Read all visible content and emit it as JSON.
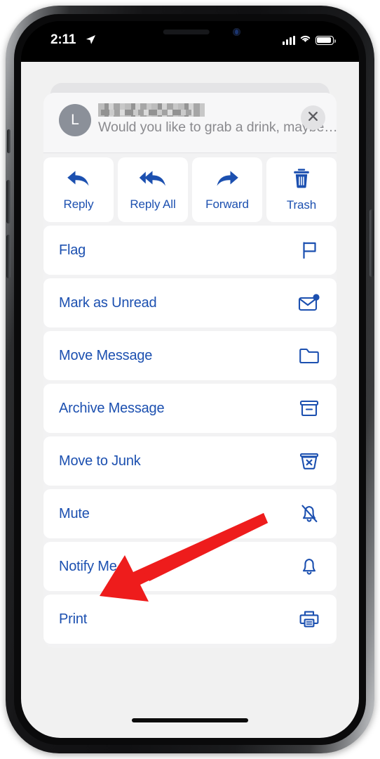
{
  "status_bar": {
    "time": "2:11",
    "location_icon": "location-arrow-icon",
    "signal_icon": "cellular-signal-icon",
    "wifi_icon": "wifi-icon",
    "battery_icon": "battery-icon"
  },
  "sheet": {
    "header": {
      "avatar_initial": "L",
      "sender_name_redacted": "",
      "preview": "Would you like to grab a drink, maybe…",
      "close_icon": "close-icon"
    },
    "quick_actions": [
      {
        "label": "Reply",
        "icon": "reply-arrow-icon"
      },
      {
        "label": "Reply All",
        "icon": "reply-all-arrow-icon"
      },
      {
        "label": "Forward",
        "icon": "forward-arrow-icon"
      },
      {
        "label": "Trash",
        "icon": "trash-icon"
      }
    ],
    "menu_items": [
      {
        "label": "Flag",
        "icon": "flag-icon"
      },
      {
        "label": "Mark as Unread",
        "icon": "envelope-badge-icon"
      },
      {
        "label": "Move Message",
        "icon": "folder-icon"
      },
      {
        "label": "Archive Message",
        "icon": "archive-box-icon"
      },
      {
        "label": "Move to Junk",
        "icon": "junk-bin-icon"
      },
      {
        "label": "Mute",
        "icon": "bell-slash-icon"
      },
      {
        "label": "Notify Me",
        "icon": "bell-icon"
      },
      {
        "label": "Print",
        "icon": "printer-icon"
      }
    ]
  },
  "annotation": {
    "arrow_color": "#ee1c1c",
    "points_to": "Print"
  },
  "colors": {
    "accent_blue": "#1c50b0",
    "sheet_bg": "#f2f2f3",
    "row_bg": "#ffffff",
    "muted_text": "#8a8a8e",
    "annotation_red": "#ee1c1c"
  },
  "home_indicator": "home-indicator"
}
